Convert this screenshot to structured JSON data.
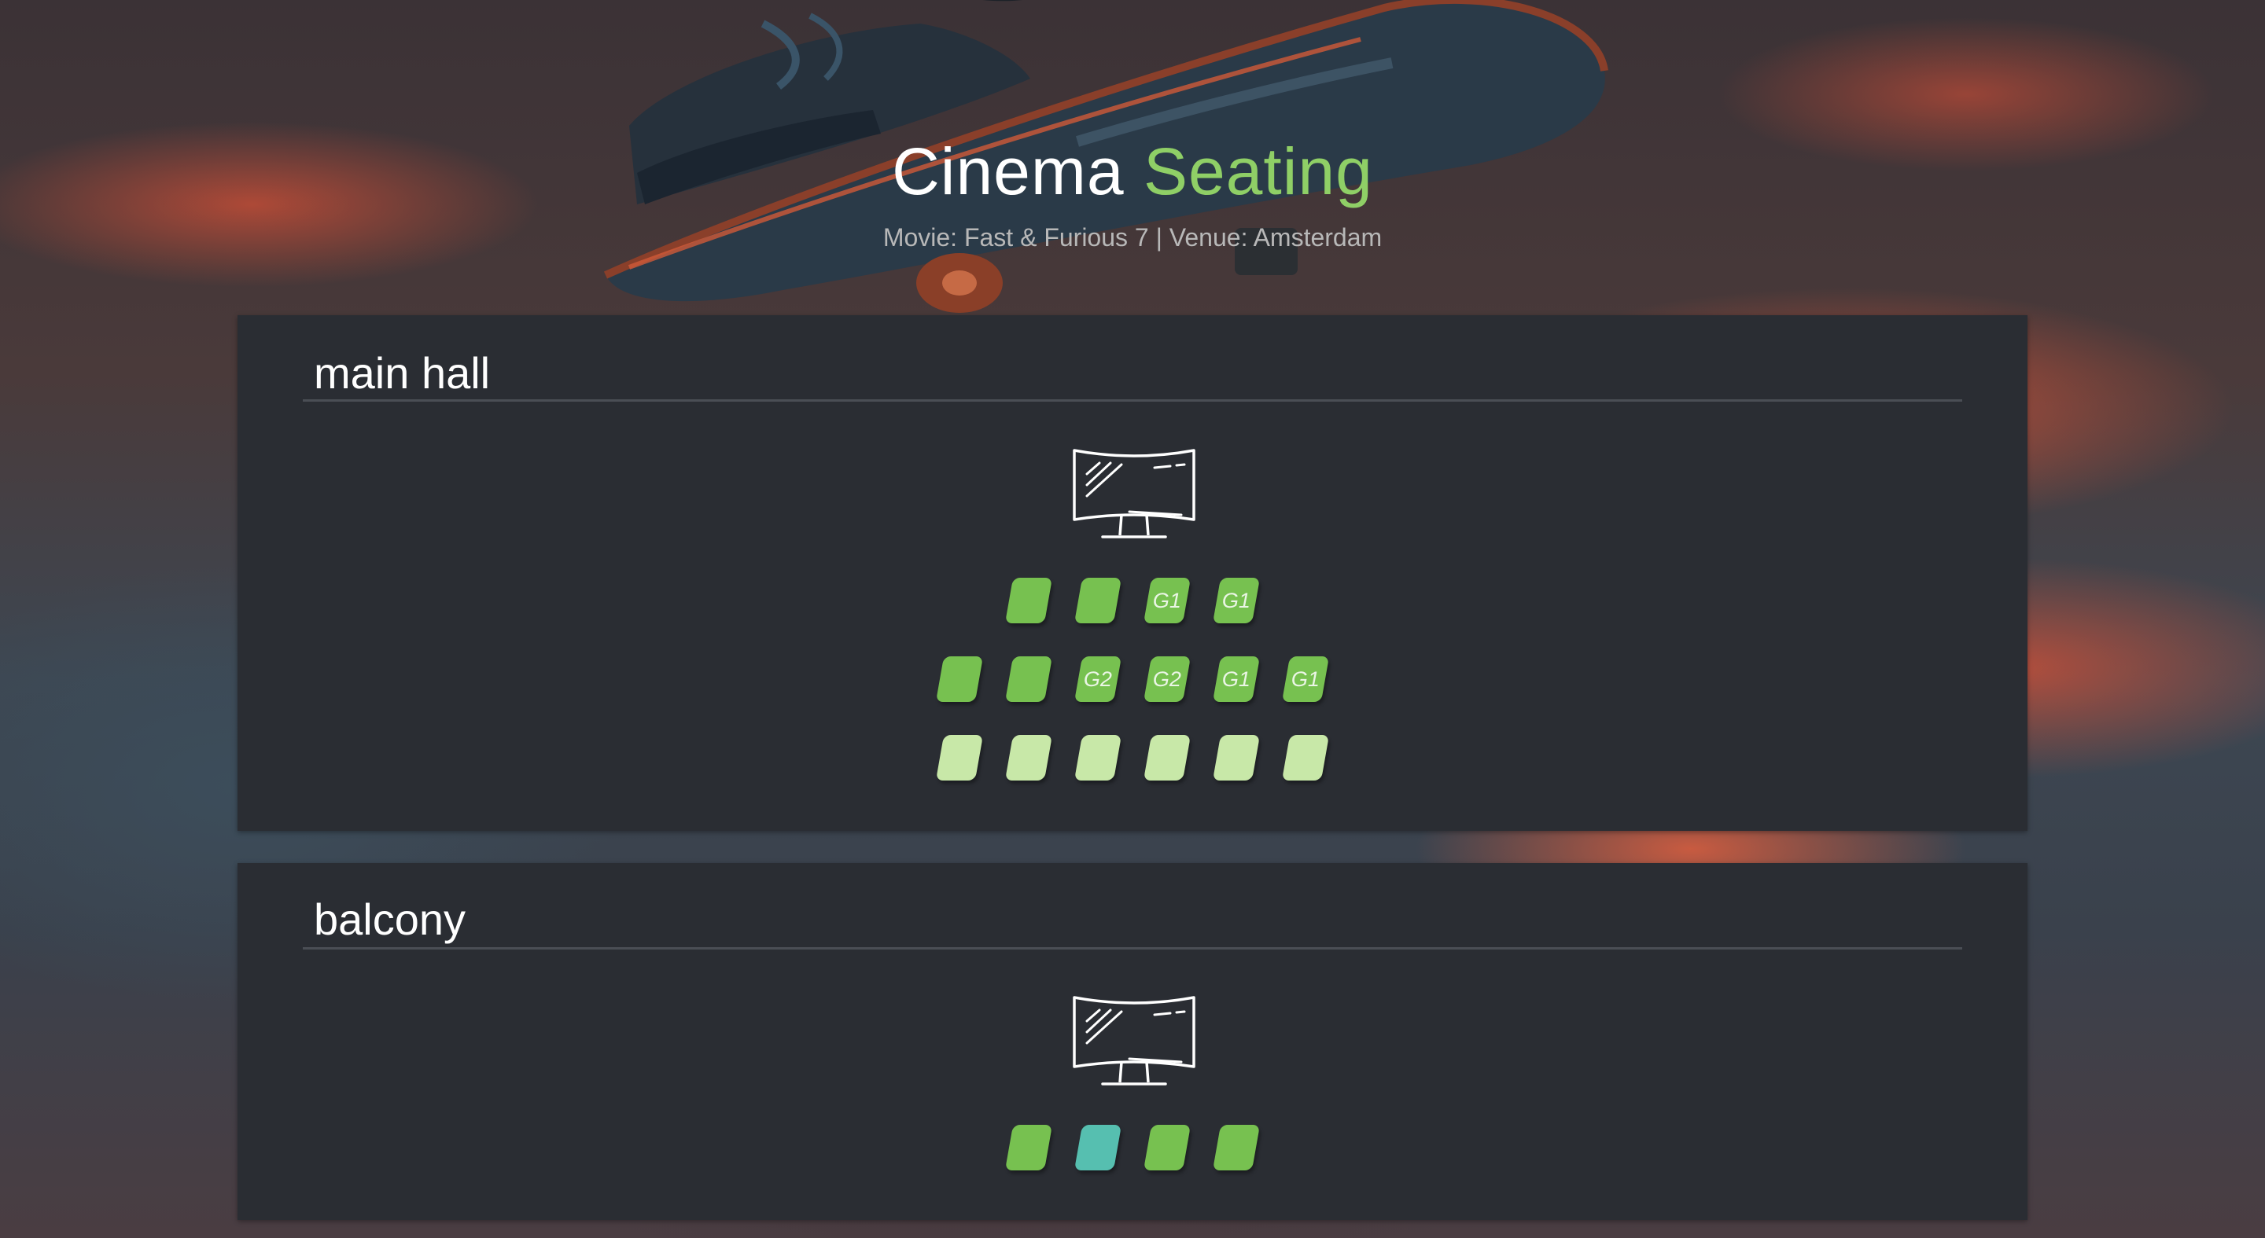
{
  "header": {
    "title_main": "Cinema",
    "title_accent": "Seating",
    "subtitle": "Movie: Fast & Furious 7 | Venue: Amsterdam"
  },
  "colors": {
    "accent": "#8fcf66",
    "seat_taken": "#77c150",
    "seat_free": "#c8e8a8",
    "seat_selected": "#56bfb0",
    "panel_bg": "#2a2d33"
  },
  "halls": [
    {
      "name": "main hall",
      "rows": [
        [
          {
            "status": "taken",
            "label": ""
          },
          {
            "status": "taken",
            "label": ""
          },
          {
            "status": "taken",
            "label": "G1"
          },
          {
            "status": "taken",
            "label": "G1"
          }
        ],
        [
          {
            "status": "taken",
            "label": ""
          },
          {
            "status": "taken",
            "label": ""
          },
          {
            "status": "taken",
            "label": "G2"
          },
          {
            "status": "taken",
            "label": "G2"
          },
          {
            "status": "taken",
            "label": "G1"
          },
          {
            "status": "taken",
            "label": "G1"
          }
        ],
        [
          {
            "status": "free",
            "label": ""
          },
          {
            "status": "free",
            "label": ""
          },
          {
            "status": "free",
            "label": ""
          },
          {
            "status": "free",
            "label": ""
          },
          {
            "status": "free",
            "label": ""
          },
          {
            "status": "free",
            "label": ""
          }
        ]
      ]
    },
    {
      "name": "balcony",
      "rows": [
        [
          {
            "status": "taken",
            "label": ""
          },
          {
            "status": "selected",
            "label": ""
          },
          {
            "status": "taken",
            "label": ""
          },
          {
            "status": "taken",
            "label": ""
          }
        ]
      ]
    }
  ]
}
